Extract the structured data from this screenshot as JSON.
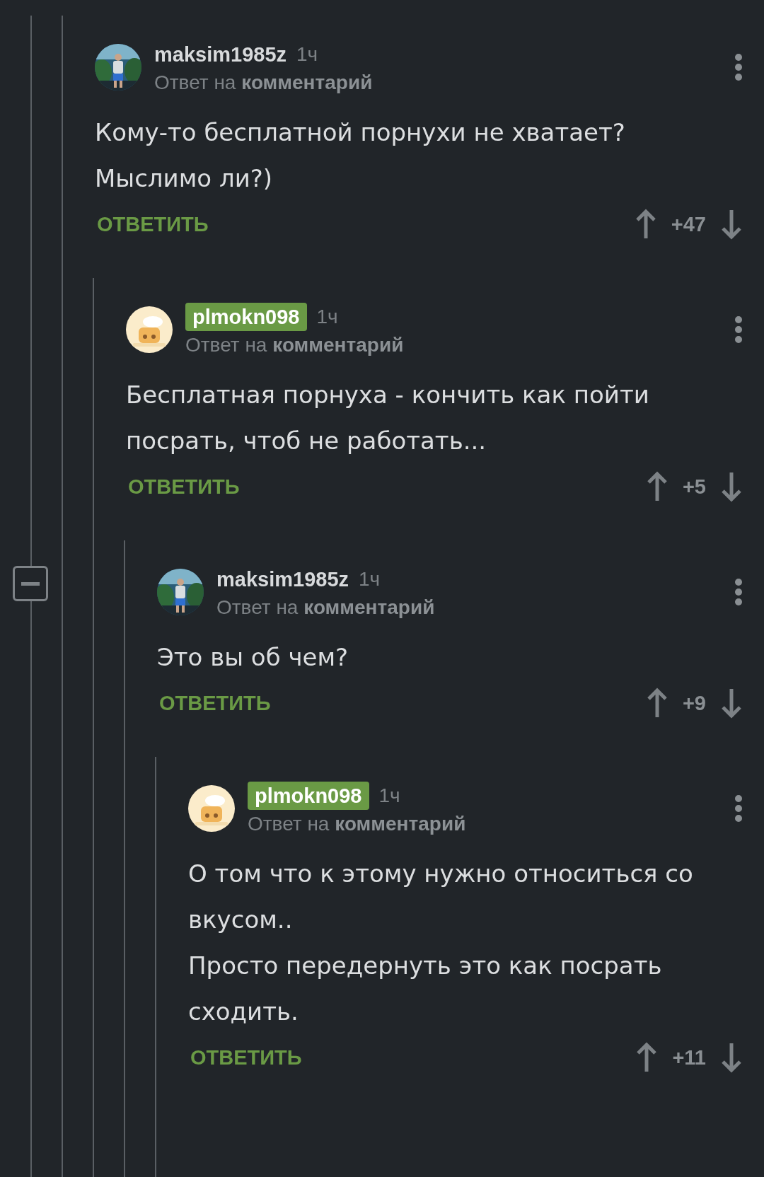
{
  "comments": [
    {
      "author": "maksim1985z",
      "author_highlighted": false,
      "time": "1ч",
      "reply_to": "Ответ на **комментарий**",
      "text": "Кому-то бесплатной порнухи не хватает? Мыслимо ли?)",
      "reply_label": "ОТВЕТИТЬ",
      "score": "+47"
    },
    {
      "author": "plmokn098",
      "author_highlighted": true,
      "avatar": {
        "kind": "cartoon"
      },
      "time": "1ч",
      "reply_to": "Ответ на **комментарий**",
      "text": "Бесплатная порнуха - кончить как пойти посрать, чтоб не работать...",
      "reply_label": "ОТВЕТИТЬ",
      "score": "+5"
    },
    {
      "author": "maksim1985z",
      "author_highlighted": false,
      "time": "1ч",
      "reply_to": "Ответ на **комментарий**",
      "text": "Это вы об чем?",
      "reply_label": "ОТВЕТИТЬ",
      "score": "+9"
    },
    {
      "author": "plmokn098",
      "author_highlighted": true,
      "avatar": {
        "kind": "cartoon"
      },
      "time": "1ч",
      "reply_to": "Ответ на **комментарий**",
      "text": "О том что к этому нужно относиться со вкусом..\nПросто передернуть это как посрать сходить.",
      "reply_label": "ОТВЕТИТЬ",
      "score": "+11"
    }
  ]
}
